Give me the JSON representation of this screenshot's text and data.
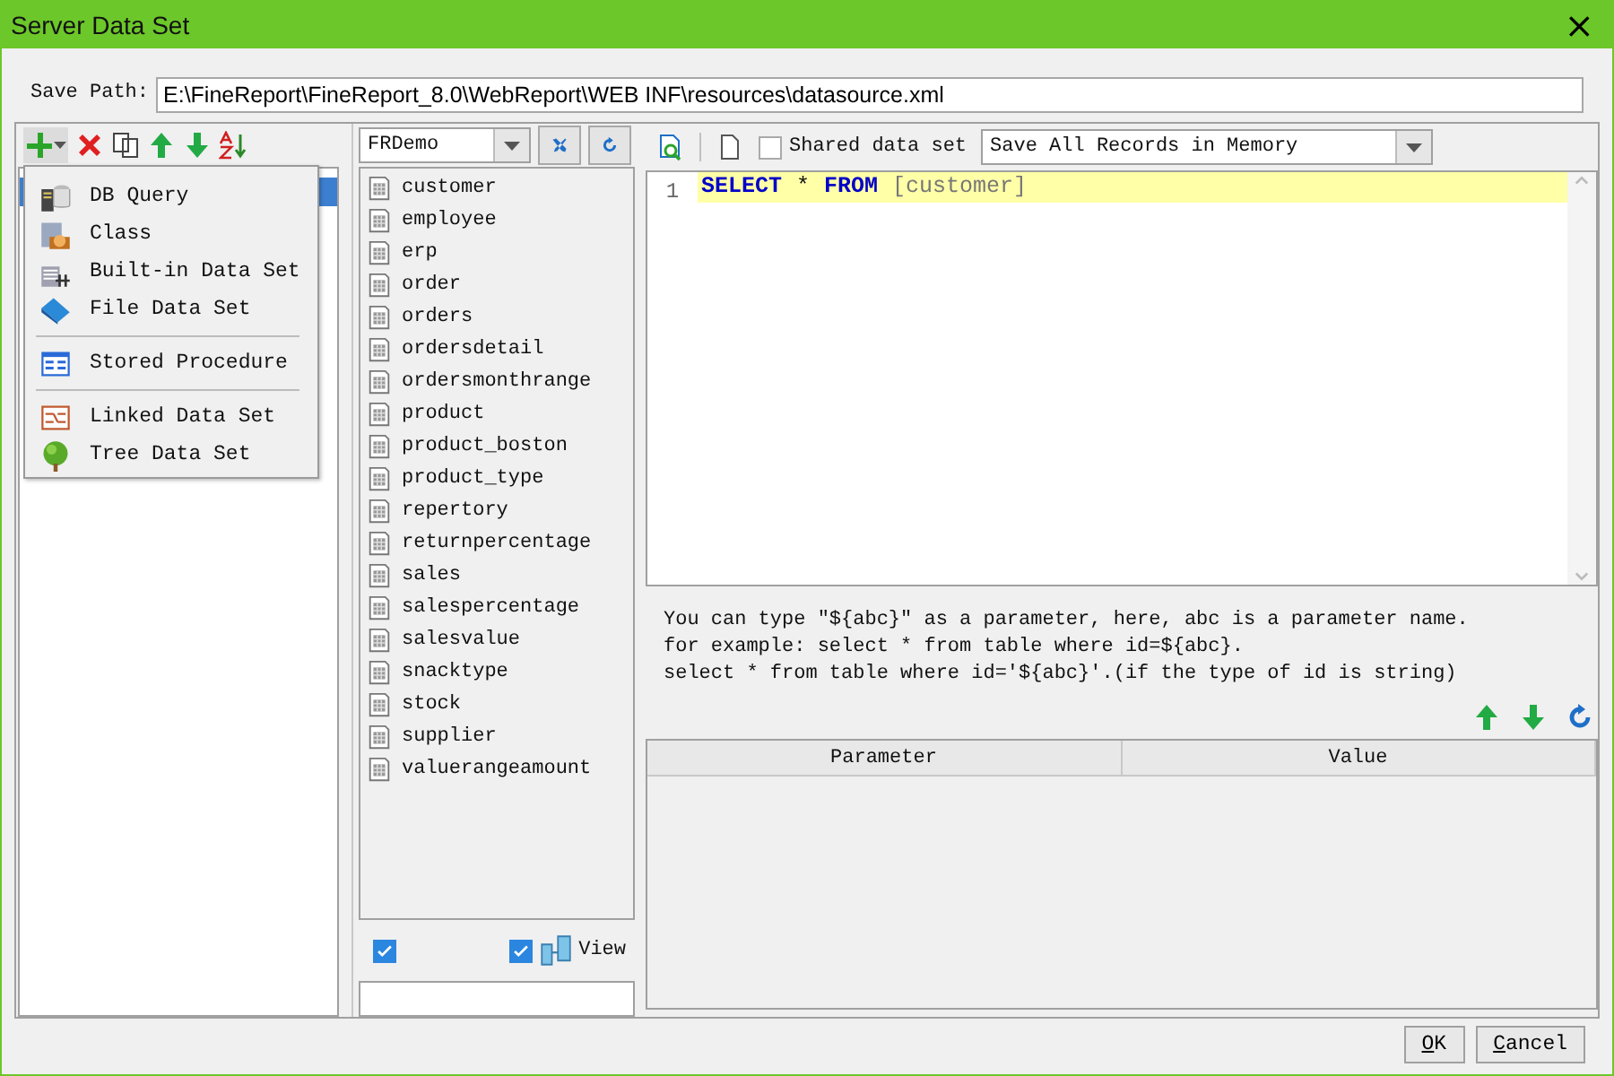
{
  "window": {
    "title": "Server Data Set",
    "close": "×"
  },
  "save_path": {
    "label": "Save Path:",
    "value": "E:\\FineReport\\FineReport_8.0\\WebReport\\WEB INF\\resources\\datasource.xml"
  },
  "datasets": [
    {
      "selected": true
    }
  ],
  "add_menu": {
    "groups": [
      [
        {
          "kind": "db",
          "label": "DB Query"
        },
        {
          "kind": "class",
          "label": "Class"
        },
        {
          "kind": "builtin",
          "label": "Built-in Data Set"
        },
        {
          "kind": "file",
          "label": "File Data Set"
        }
      ],
      [
        {
          "kind": "procedure",
          "label": "Stored Procedure"
        }
      ],
      [
        {
          "kind": "linked",
          "label": "Linked Data Set"
        },
        {
          "kind": "tree",
          "label": "Tree Data Set"
        }
      ]
    ]
  },
  "connection": {
    "value": "FRDemo"
  },
  "tables": [
    "customer",
    "employee",
    "erp",
    "order",
    "orders",
    "ordersdetail",
    "ordersmonthrange",
    "product",
    "product_boston",
    "product_type",
    "repertory",
    "returnpercentage",
    "sales",
    "salespercentage",
    "salesvalue",
    "snacktype",
    "stock",
    "supplier",
    "valuerangeamount"
  ],
  "table_options": {
    "first_checked": true,
    "view_checked": true,
    "view_label": "View"
  },
  "shared": {
    "label": "Shared data set",
    "checked": false
  },
  "memory_mode": {
    "value": "Save All Records in Memory"
  },
  "sql": {
    "line_number": "1",
    "tokens": [
      {
        "kind": "keyword",
        "text": "SELECT"
      },
      {
        "kind": "plain",
        "text": "*"
      },
      {
        "kind": "keyword",
        "text": "FROM"
      },
      {
        "kind": "name",
        "text": "[customer]"
      }
    ]
  },
  "help_lines": [
    "You can type \"${abc}\" as a parameter, here, abc is a parameter name.",
    "for example: select * from table where id=${abc}.",
    "select * from table where id='${abc}'.(if the type of id is string)"
  ],
  "parameters": {
    "columns": [
      "Parameter",
      "Value"
    ]
  },
  "buttons": [
    {
      "label": "OK",
      "first_letter_underlined": true
    },
    {
      "label": "Cancel",
      "first_letter_underlined": true
    }
  ]
}
